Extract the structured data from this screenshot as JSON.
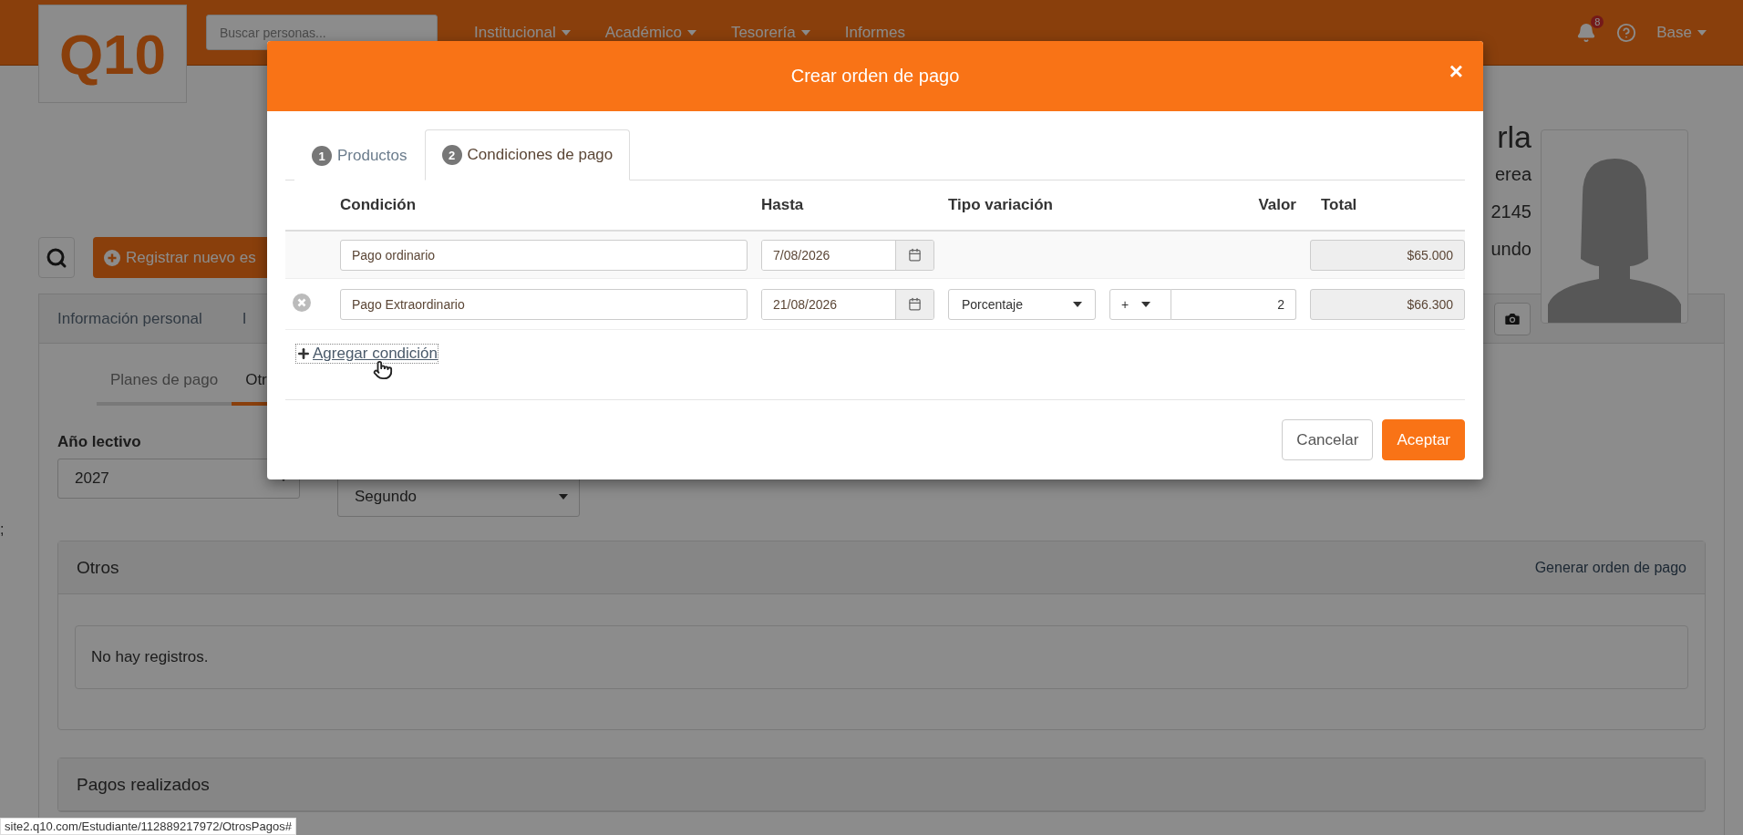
{
  "navbar": {
    "logo": "Q10",
    "search_placeholder": "Buscar personas...",
    "menu": [
      {
        "label": "Institucional",
        "dropdown": true
      },
      {
        "label": "Académico",
        "dropdown": true
      },
      {
        "label": "Tesorería",
        "dropdown": true
      },
      {
        "label": "Informes",
        "dropdown": false
      }
    ],
    "notifications": "8",
    "user": "Base"
  },
  "profile": {
    "lines": [
      "rla",
      "erea",
      "2145",
      "undo"
    ]
  },
  "toolbar": {
    "register_button": "Registrar nuevo es"
  },
  "tabs": [
    {
      "label": "Información personal",
      "selected": false
    },
    {
      "label": "I",
      "selected": false
    }
  ],
  "subtabs": [
    {
      "label": "Planes de pago",
      "selected": false
    },
    {
      "label": "Otr",
      "selected": true
    }
  ],
  "filters": [
    {
      "label": "Año lectivo",
      "value": "2027"
    },
    {
      "value": "Segundo"
    }
  ],
  "edge_mark": ";",
  "panels": [
    {
      "title": "Otros",
      "action": "Generar orden de pago",
      "empty_text": "No hay registros."
    },
    {
      "title": "Pagos realizados"
    }
  ],
  "status_bar": "site2.q10.com/Estudiante/112889217972/OtrosPagos#",
  "modal": {
    "title": "Crear orden de pago",
    "close": "×",
    "tabs": [
      {
        "number": "1",
        "label": "Productos",
        "selected": false
      },
      {
        "number": "2",
        "label": "Condiciones de pago",
        "selected": true
      }
    ],
    "columns": [
      "Condición",
      "Hasta",
      "Tipo variación",
      "Valor",
      "Total"
    ],
    "rows": [
      {
        "kind": "base",
        "condition": "Pago ordinario",
        "date": "7/08/2026",
        "total": "$65.000"
      },
      {
        "kind": "variation",
        "condition": "Pago Extraordinario",
        "date": "21/08/2026",
        "variation_type": "Porcentaje",
        "sign": "+",
        "value": "2",
        "total": "$66.300"
      }
    ],
    "add_link": "Agregar condición",
    "cancel": "Cancelar",
    "accept": "Aceptar"
  }
}
